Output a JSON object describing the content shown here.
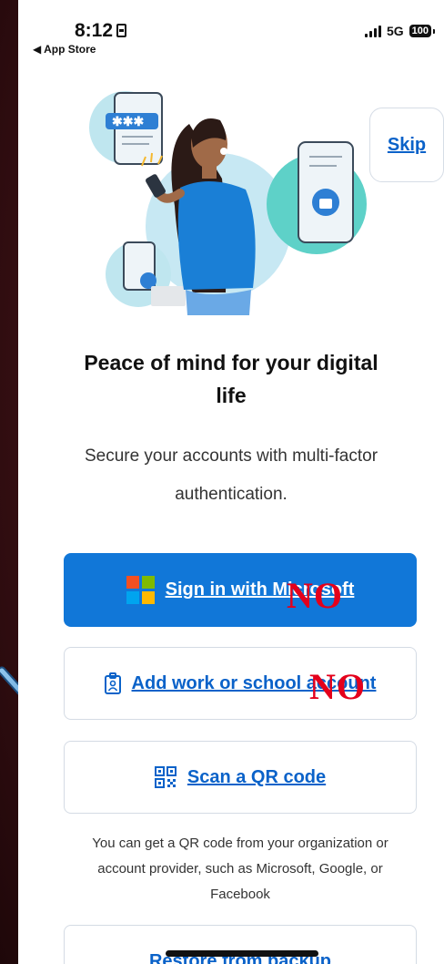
{
  "status_bar": {
    "time": "8:12",
    "back_label": "◀ App Store",
    "network": "5G",
    "battery": "100"
  },
  "skip_label": "Skip",
  "title": "Peace of mind for your digital life",
  "subtitle": "Secure your accounts with multi-factor authentication.",
  "buttons": {
    "signin_label": "Sign in with Microsoft",
    "work_label": "Add work or school account",
    "qr_label": "Scan a QR code",
    "restore_label": "Restore from backup"
  },
  "annotations": {
    "no_1": "NO",
    "no_2": "NO"
  },
  "info_text": "You can get a QR code from your organization or account provider, such as Microsoft, Google, or Facebook",
  "colors": {
    "primary": "#1177d8",
    "link": "#0a62c9",
    "annotation_red": "#e4001b",
    "background": "#3a1014"
  }
}
